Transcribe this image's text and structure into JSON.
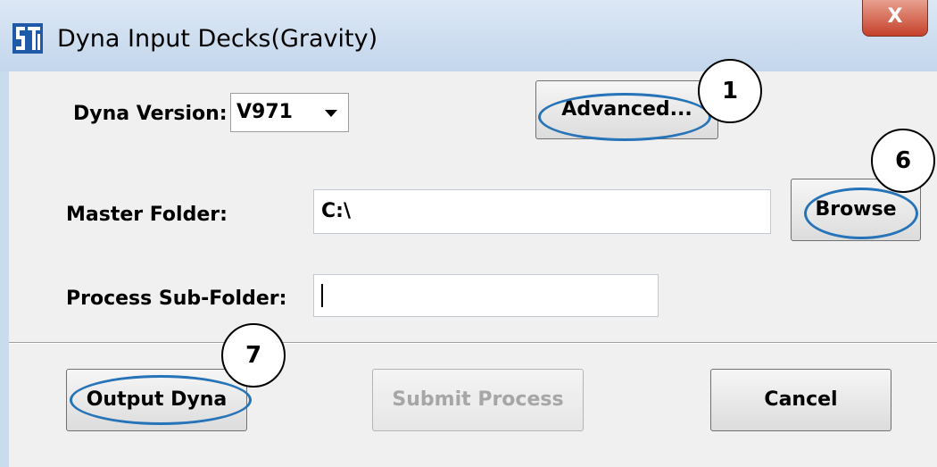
{
  "window": {
    "title": "Dyna Input Decks(Gravity)",
    "close_label": "X"
  },
  "form": {
    "dyna_version_label": "Dyna Version:",
    "dyna_version_value": "V971",
    "master_folder_label": "Master Folder:",
    "master_folder_value": "C:\\",
    "process_subfolder_label": "Process Sub-Folder:",
    "process_subfolder_value": ""
  },
  "buttons": {
    "advanced": "Advanced...",
    "browse": "Browse",
    "output_dyna": "Output Dyna",
    "submit_process": "Submit Process",
    "cancel": "Cancel"
  },
  "callouts": {
    "one": "1",
    "six": "6",
    "seven": "7"
  },
  "colors": {
    "highlight": "#2673b8",
    "dialog_bg": "#f0f0f0",
    "title_bar": "#c9dbee"
  },
  "icons": {
    "app": "app-logo-icon",
    "dropdown": "chevron-down-icon",
    "close": "close-icon"
  }
}
